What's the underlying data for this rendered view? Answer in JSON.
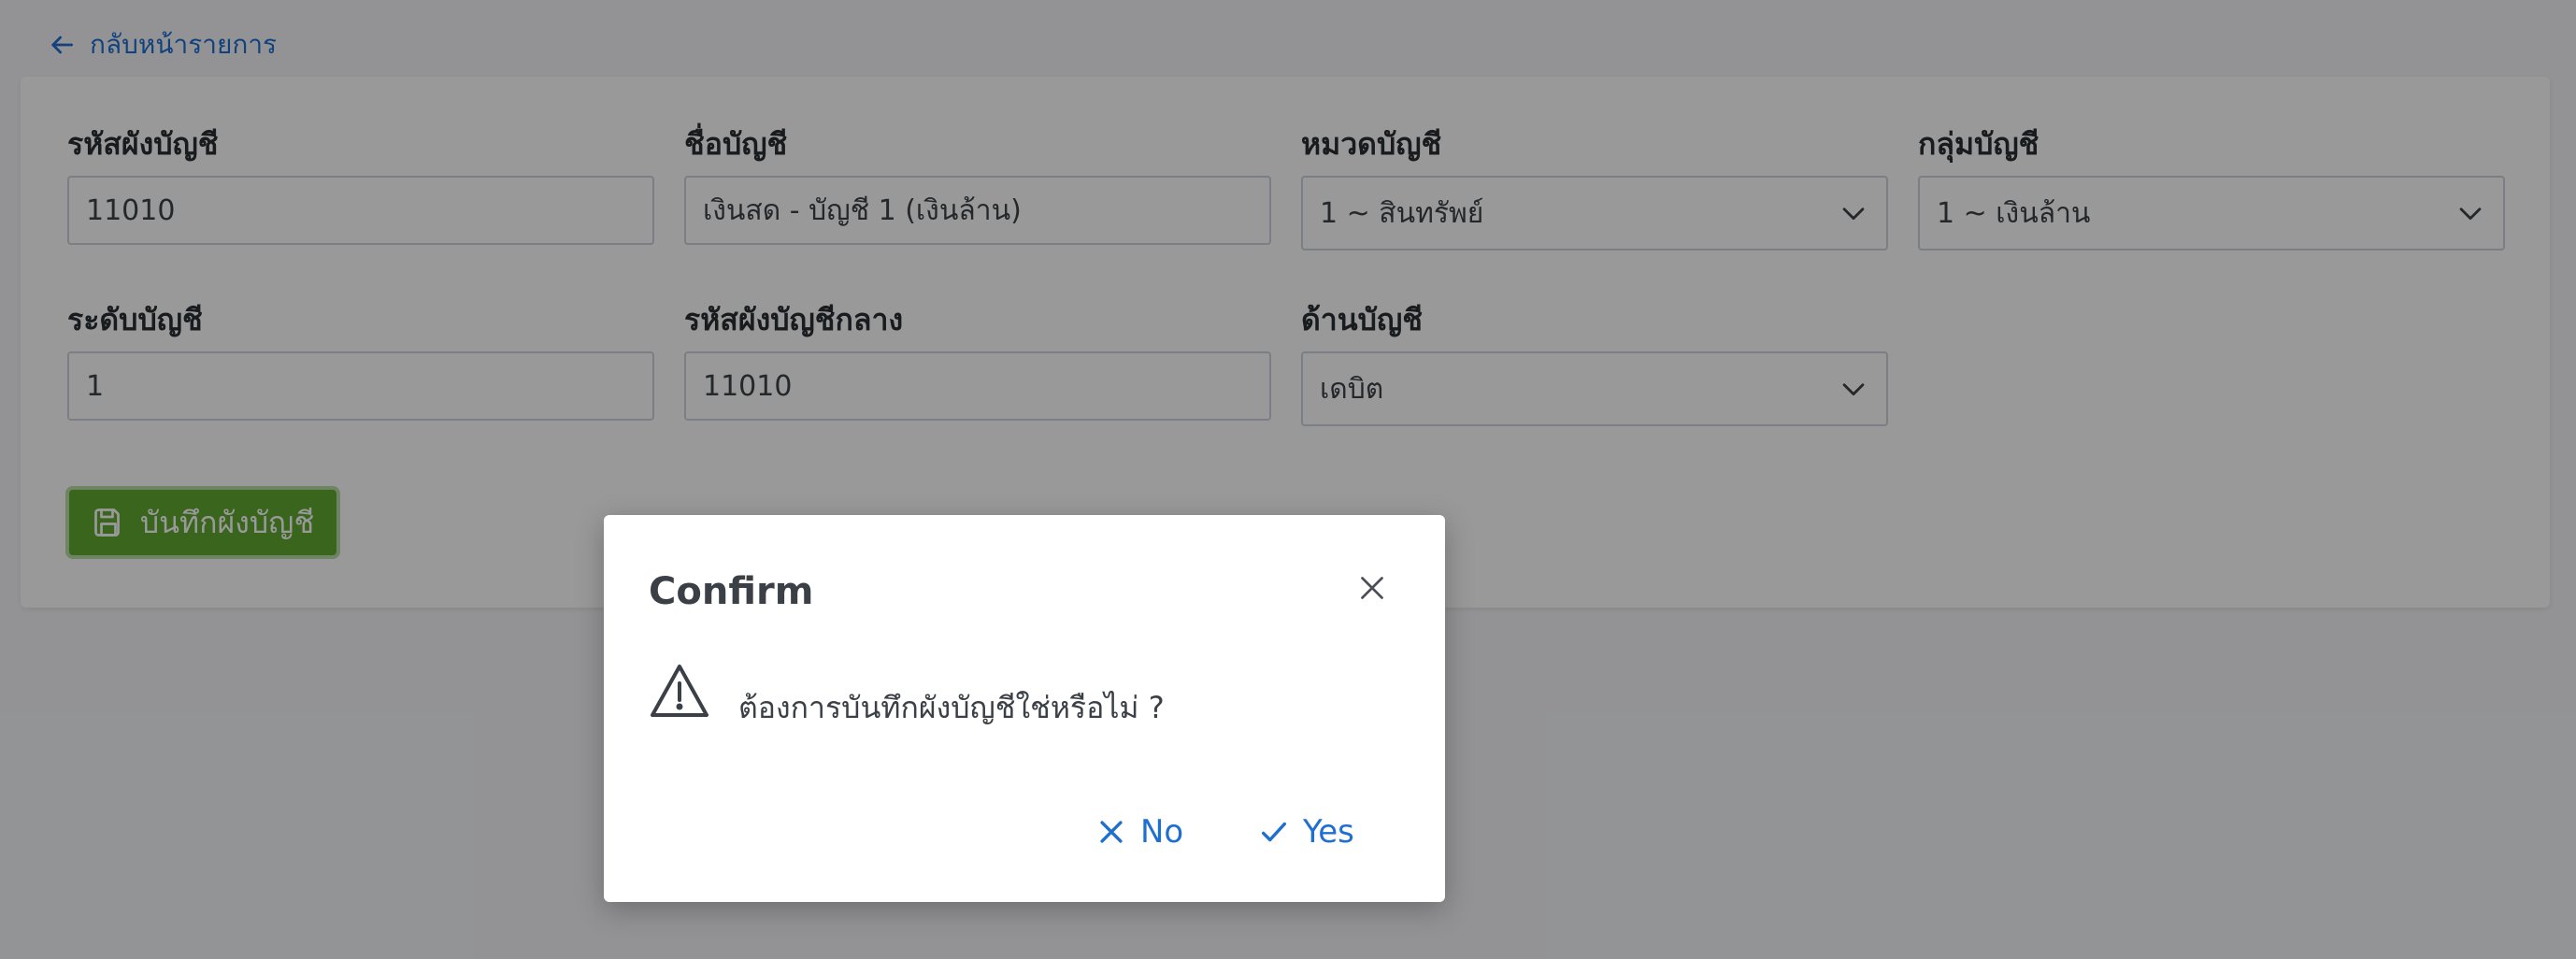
{
  "back_link": {
    "label": "กลับหน้ารายการ",
    "icon": "arrow-left-icon"
  },
  "form": {
    "account_code": {
      "label": "รหัสผังบัญชี",
      "value": "11010"
    },
    "account_name": {
      "label": "ชื่อบัญชี",
      "value": "เงินสด - บัญชี 1 (เงินล้าน)"
    },
    "account_category": {
      "label": "หมวดบัญชี",
      "value": "1 ~ สินทรัพย์"
    },
    "account_group": {
      "label": "กลุ่มบัญชี",
      "value": "1 ~ เงินล้าน"
    },
    "account_level": {
      "label": "ระดับบัญชี",
      "value": "1"
    },
    "central_code": {
      "label": "รหัสผังบัญชีกลาง",
      "value": "11010"
    },
    "account_side": {
      "label": "ด้านบัญชี",
      "value": "เดบิต"
    },
    "save_button": {
      "label": "บันทึกผังบัญชี",
      "icon": "floppy-disk-icon"
    }
  },
  "dialog": {
    "title": "Confirm",
    "message": "ต้องการบันทึกผังบัญชีใช่หรือไม่ ?",
    "no_label": "No",
    "yes_label": "Yes",
    "icons": {
      "close": "close-icon",
      "warning": "warning-triangle-icon",
      "no": "x-icon",
      "yes": "check-icon"
    }
  },
  "colors": {
    "accent": "#1f6fd1",
    "save_button": "#5fa831",
    "overlay": "rgba(0,0,0,0.40)"
  }
}
